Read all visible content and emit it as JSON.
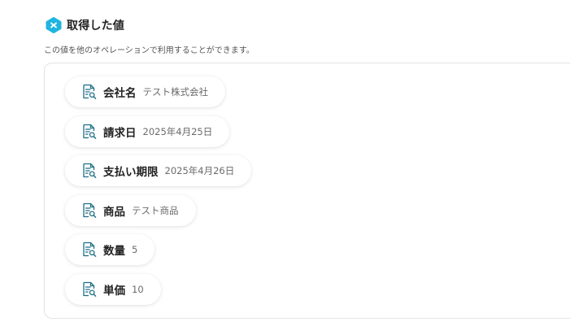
{
  "section": {
    "title": "取得した値",
    "description": "この値を他のオペレーションで利用することができます。",
    "icon": "variable-badge-icon",
    "accent_color": "#1fb5e0"
  },
  "values": [
    {
      "label": "会社名",
      "value": "テスト株式会社",
      "icon": "document-search-icon"
    },
    {
      "label": "請求日",
      "value": "2025年4月25日",
      "icon": "document-search-icon"
    },
    {
      "label": "支払い期限",
      "value": "2025年4月26日",
      "icon": "document-search-icon"
    },
    {
      "label": "商品",
      "value": "テスト商品",
      "icon": "document-search-icon"
    },
    {
      "label": "数量",
      "value": "5",
      "icon": "document-search-icon"
    },
    {
      "label": "単価",
      "value": "10",
      "icon": "document-search-icon"
    }
  ]
}
